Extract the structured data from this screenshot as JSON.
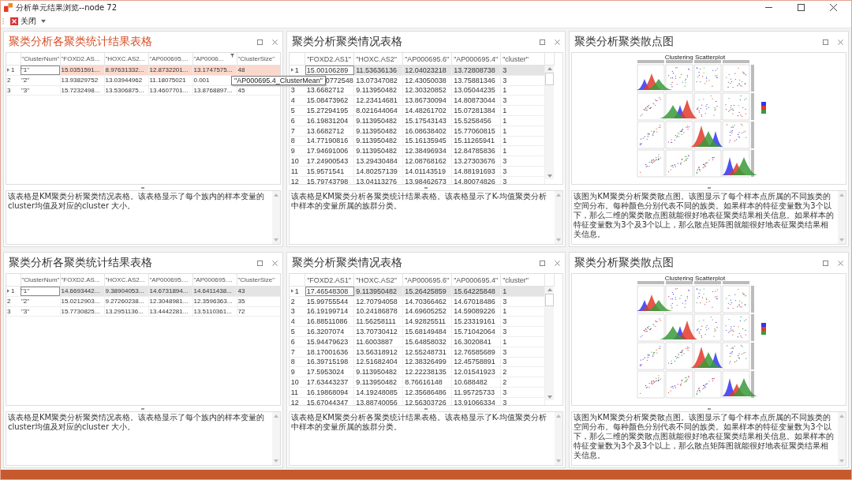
{
  "window": {
    "title": "分析单元结果浏览--node 72"
  },
  "toolbar": {
    "close_label": "关闭"
  },
  "tooltip": {
    "text": "\"AP000695.4_ClusterMean\""
  },
  "panels": [
    {
      "kind": "stats_table",
      "title": "聚类分析各聚类统计结果表格",
      "active": true,
      "columns": [
        {
          "label": "\"ClusterNum\"",
          "filtered": false
        },
        {
          "label": "\"FOXD2.AS...",
          "filtered": false
        },
        {
          "label": "\"HOXC.AS2...",
          "filtered": false
        },
        {
          "label": "\"AP000695....",
          "filtered": false
        },
        {
          "label": "\"AP0006...",
          "filtered": true
        },
        {
          "label": "\"ClusterSize\"",
          "filtered": false
        }
      ],
      "rows": [
        {
          "index": "1",
          "selected": true,
          "covered": false,
          "cells": [
            "\"1\"",
            "15.0351591...",
            "8.97631332...",
            "12.8732201...",
            "13.1747575...",
            "48"
          ]
        },
        {
          "index": "2",
          "selected": false,
          "covered": false,
          "cells": [
            "\"2\"",
            "13.93829752",
            "13.03944962",
            "11.18075021",
            "0.001"
          ]
        },
        {
          "index": "3",
          "selected": false,
          "covered": false,
          "cells": [
            "\"3\"",
            "15.7232498...",
            "13.5306875...",
            "13.4607701...",
            "13.8768897...",
            "45"
          ]
        }
      ],
      "description": "该表格是KM聚类分析聚类情况表格。该表格显示了每个族内的样本变量的cluster均值及对应的cluster 大小。"
    },
    {
      "kind": "data_table",
      "title": "聚类分析聚类情况表格",
      "active": false,
      "columns": [
        {
          "label": "\"FOXD2.AS1\"",
          "filtered": false
        },
        {
          "label": "\"HOXC.AS2\"",
          "filtered": false
        },
        {
          "label": "\"AP000695.6\"",
          "filtered": false
        },
        {
          "label": "\"AP000695.4\"",
          "filtered": false
        },
        {
          "label": "\"cluster\"",
          "filtered": false
        }
      ],
      "rows": [
        {
          "index": "1",
          "selected": true,
          "covered": false,
          "cells": [
            "15.00106289",
            "11.53636136",
            "12.04023218",
            "13.72808738",
            "3"
          ]
        },
        {
          "selected": false,
          "covered": true,
          "cells": [
            "0772548",
            "13.07347082",
            "12.43050038",
            "13.75881346",
            "3"
          ]
        },
        {
          "index": "3",
          "selected": false,
          "covered": false,
          "cells": [
            "13.6682712",
            "9.113950482",
            "12.30320852",
            "13.05044235",
            "1"
          ]
        },
        {
          "index": "4",
          "selected": false,
          "covered": false,
          "cells": [
            "15.08473962",
            "12.23414681",
            "13.86730094",
            "14.80873044",
            "3"
          ]
        },
        {
          "index": "5",
          "selected": false,
          "covered": false,
          "cells": [
            "15.27294195",
            "8.021644064",
            "14.48261702",
            "15.07281384",
            "1"
          ]
        },
        {
          "index": "6",
          "selected": false,
          "covered": false,
          "cells": [
            "16.19831204",
            "9.113950482",
            "15.17543143",
            "15.5258456",
            "1"
          ]
        },
        {
          "index": "7",
          "selected": false,
          "covered": false,
          "cells": [
            "13.6682712",
            "9.113950482",
            "16.08638402",
            "15.77060815",
            "1"
          ]
        },
        {
          "index": "8",
          "selected": false,
          "covered": false,
          "cells": [
            "14.77190816",
            "9.113950482",
            "15.16135945",
            "15.11265941",
            "1"
          ]
        },
        {
          "index": "9",
          "selected": false,
          "covered": false,
          "cells": [
            "17.94691006",
            "9.113950482",
            "12.38496934",
            "12.84785836",
            "1"
          ]
        },
        {
          "index": "10",
          "selected": false,
          "covered": false,
          "cells": [
            "17.24900543",
            "13.29430484",
            "12.08768162",
            "13.27303676",
            "3"
          ]
        },
        {
          "index": "11",
          "selected": false,
          "covered": false,
          "cells": [
            "15.9571541",
            "14.80257139",
            "14.01143519",
            "14.88191693",
            "3"
          ]
        },
        {
          "index": "12",
          "selected": false,
          "covered": false,
          "cells": [
            "15.79743798",
            "13.04113276",
            "13.98462673",
            "14.80074826",
            "3"
          ]
        }
      ],
      "description": "该表格是KM聚类分析各聚类统计结果表格。该表格显示了K-均值聚类分析中样本的变量所属的族群分类。"
    },
    {
      "kind": "scatter",
      "title": "聚类分析聚类散点图",
      "active": false,
      "plot_title": "Clustering Scatterplot",
      "description": "该图为KM聚类分析聚类散点图。该图显示了每个样本点所属的不同族类的空间分布。每种颜色分别代表不同的族类。如果样本的特征变量数为3个以下，那么二维的聚类散点图就能很好地表征聚类结果相关信息。如果样本的特征变量数为3个及3个以上，那么散点矩阵图就能很好地表征聚类结果相关信息。"
    },
    {
      "kind": "stats_table",
      "title": "聚类分析各聚类统计结果表格",
      "active": false,
      "columns": [
        {
          "label": "\"ClusterNum\"",
          "filtered": false
        },
        {
          "label": "\"FOXD2.AS...",
          "filtered": false
        },
        {
          "label": "\"HOXC.AS2...",
          "filtered": false
        },
        {
          "label": "\"AP000695....",
          "filtered": false
        },
        {
          "label": "\"AP000695....",
          "filtered": false
        },
        {
          "label": "\"ClusterSize\"",
          "filtered": false
        }
      ],
      "rows": [
        {
          "index": "1",
          "selected": true,
          "covered": false,
          "cells": [
            "\"1\"",
            "14.6693442...",
            "9.38904053...",
            "14.6731894...",
            "14.6411438...",
            "43"
          ]
        },
        {
          "index": "2",
          "selected": false,
          "covered": false,
          "cells": [
            "\"2\"",
            "15.0212903...",
            "9.27260238...",
            "12.3048981...",
            "12.3596363...",
            "35"
          ]
        },
        {
          "index": "3",
          "selected": false,
          "covered": false,
          "cells": [
            "\"3\"",
            "15.7730825...",
            "13.2951136...",
            "13.4442281...",
            "13.5110361...",
            "72"
          ]
        }
      ],
      "description": "该表格是KM聚类分析聚类情况表格。该表格显示了每个族内的样本变量的cluster均值及对应的cluster 大小。"
    },
    {
      "kind": "data_table",
      "title": "聚类分析聚类情况表格",
      "active": false,
      "columns": [
        {
          "label": "\"FOXD2.AS1\"",
          "filtered": false
        },
        {
          "label": "\"HOXC.AS2\"",
          "filtered": false
        },
        {
          "label": "\"AP000695.6\"",
          "filtered": false
        },
        {
          "label": "\"AP000695.4\"",
          "filtered": false
        },
        {
          "label": "\"cluster\"",
          "filtered": false
        }
      ],
      "rows": [
        {
          "index": "1",
          "selected": true,
          "covered": false,
          "cells": [
            "17.46548308",
            "9.113950482",
            "15.26425859",
            "15.64225848",
            "1"
          ]
        },
        {
          "index": "2",
          "selected": false,
          "covered": false,
          "cells": [
            "15.99755544",
            "12.70794058",
            "14.70366462",
            "14.67018486",
            "3"
          ]
        },
        {
          "index": "3",
          "selected": false,
          "covered": false,
          "cells": [
            "16.19199714",
            "10.24186878",
            "14.69605252",
            "14.59089226",
            "1"
          ]
        },
        {
          "index": "4",
          "selected": false,
          "covered": false,
          "cells": [
            "16.88511086",
            "11.56258111",
            "14.92825511",
            "15.23319161",
            "3"
          ]
        },
        {
          "index": "5",
          "selected": false,
          "covered": false,
          "cells": [
            "16.3207074",
            "13.70730412",
            "15.68149484",
            "15.71042064",
            "3"
          ]
        },
        {
          "index": "6",
          "selected": false,
          "covered": false,
          "cells": [
            "15.94479623",
            "11.6003887",
            "15.64858032",
            "16.3020841",
            "1"
          ]
        },
        {
          "index": "7",
          "selected": false,
          "covered": false,
          "cells": [
            "18.17001636",
            "13.56318912",
            "12.55248731",
            "12.76585689",
            "3"
          ]
        },
        {
          "index": "8",
          "selected": false,
          "covered": false,
          "cells": [
            "16.39715198",
            "12.51682404",
            "12.38326499",
            "12.45758891",
            "3"
          ]
        },
        {
          "index": "9",
          "selected": false,
          "covered": false,
          "cells": [
            "17.5953024",
            "9.113950482",
            "12.22238135",
            "12.01541923",
            "2"
          ]
        },
        {
          "index": "10",
          "selected": false,
          "covered": false,
          "cells": [
            "17.63443237",
            "9.113950482",
            "8.76616148",
            "10.688482",
            "2"
          ]
        },
        {
          "index": "11",
          "selected": false,
          "covered": false,
          "cells": [
            "16.19868094",
            "14.19248085",
            "12.35686486",
            "11.95725733",
            "3"
          ]
        },
        {
          "index": "12",
          "selected": false,
          "covered": false,
          "cells": [
            "15.67044347",
            "13.88740056",
            "12.56303726",
            "13.91066334",
            "3"
          ]
        }
      ],
      "description": "该表格是KM聚类分析各聚类统计结果表格。该表格显示了K-均值聚类分析中样本的变量所属的族群分类。"
    },
    {
      "kind": "scatter",
      "title": "聚类分析聚类散点图",
      "active": false,
      "plot_title": "Clustering Scatterplot",
      "description": "该图为KM聚类分析聚类散点图。该图显示了每个样本点所属的不同族类的空间分布。每种颜色分别代表不同的族类。如果样本的特征变量数为3个以下，那么二维的聚类散点图就能很好地表征聚类结果相关信息。如果样本的特征变量数为3个及3个以上，那么散点矩阵图就能很好地表征聚类结果相关信息。"
    }
  ]
}
